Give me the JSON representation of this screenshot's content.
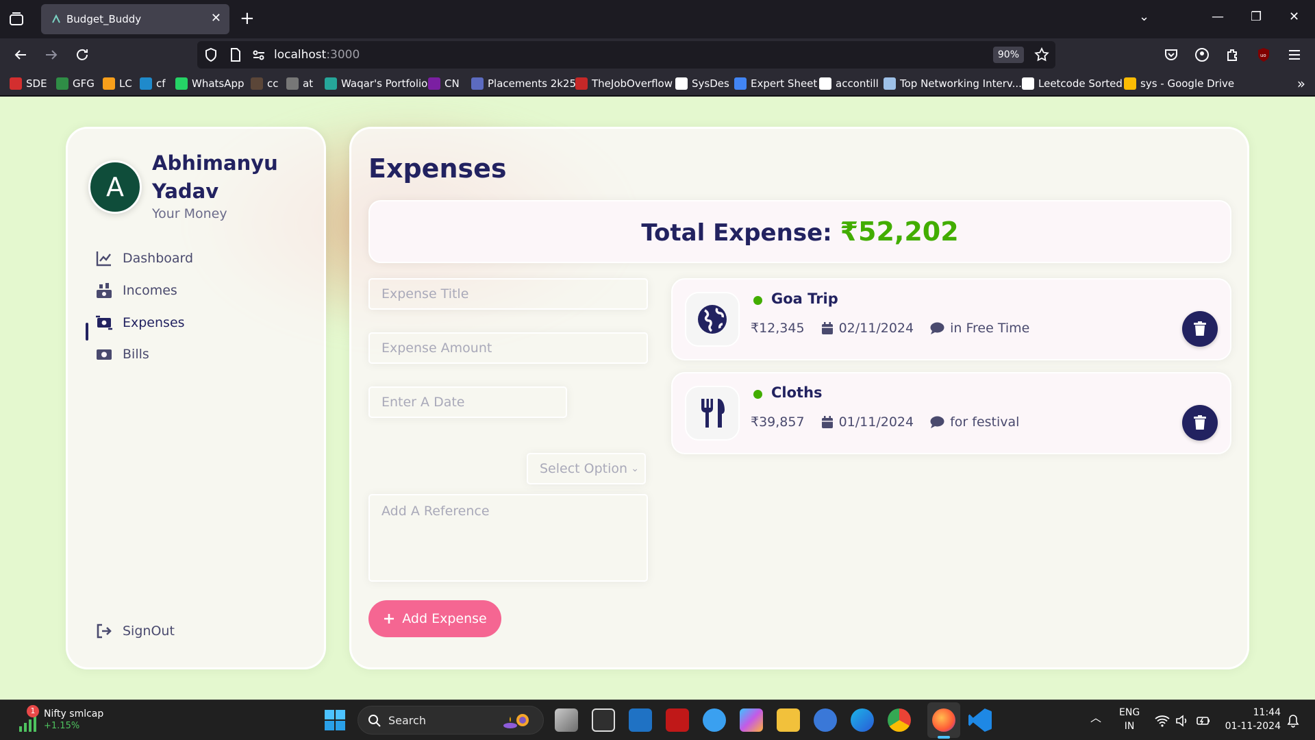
{
  "browser": {
    "tab_title": "Budget_Buddy",
    "url_host": "localhost",
    "url_port": ":3000",
    "zoom": "90%",
    "bookmarks": [
      {
        "label": "SDE",
        "icon": "tuf-icon",
        "color": "#d32f2f"
      },
      {
        "label": "GFG",
        "icon": "gfg-icon",
        "color": "#2f8d46"
      },
      {
        "label": "LC",
        "icon": "leetcode-icon",
        "color": "#f89f1b"
      },
      {
        "label": "cf",
        "icon": "codeforces-icon",
        "color": "#1f8acb"
      },
      {
        "label": "WhatsApp",
        "icon": "whatsapp-icon",
        "color": "#25d366"
      },
      {
        "label": "cc",
        "icon": "codechef-icon",
        "color": "#5b4638"
      },
      {
        "label": "at",
        "icon": "atcoder-icon",
        "color": "#777777"
      },
      {
        "label": "Waqar's Portfolio",
        "icon": "portfolio-icon",
        "color": "#26a69a"
      },
      {
        "label": "CN",
        "icon": "cn-icon",
        "color": "#7b1fa2"
      },
      {
        "label": "Placements 2k25",
        "icon": "people-icon",
        "color": "#5c6bc0"
      },
      {
        "label": "TheJobOverflow",
        "icon": "jobs-icon",
        "color": "#c62828"
      },
      {
        "label": "SysDes",
        "icon": "github-icon",
        "color": "#ffffff"
      },
      {
        "label": "Expert Sheet",
        "icon": "docs-icon",
        "color": "#4285f4"
      },
      {
        "label": "accontill",
        "icon": "github-icon",
        "color": "#ffffff"
      },
      {
        "label": "Top Networking Interv...",
        "icon": "mountain-icon",
        "color": "#9ec1e8"
      },
      {
        "label": "Leetcode Sorted",
        "icon": "globe-icon",
        "color": "#ffffff"
      },
      {
        "label": "sys - Google Drive",
        "icon": "drive-icon",
        "color": "#fbbc04"
      }
    ]
  },
  "sidebar": {
    "avatar_letter": "A",
    "user_name": "Abhimanyu Yadav",
    "tagline": "Your Money",
    "items": [
      {
        "label": "Dashboard",
        "icon": "chart-line-icon"
      },
      {
        "label": "Incomes",
        "icon": "money-stack-icon"
      },
      {
        "label": "Expenses",
        "icon": "money-exchange-icon"
      },
      {
        "label": "Bills",
        "icon": "money-bill-icon"
      }
    ],
    "active_item": "Expenses",
    "signout_label": "SignOut"
  },
  "main": {
    "title": "Expenses",
    "total_label": "Total Expense:",
    "total_amount": "₹52,202",
    "form": {
      "title_placeholder": "Expense Title",
      "amount_placeholder": "Expense Amount",
      "date_placeholder": "Enter A Date",
      "category_selected": "Select Option",
      "reference_placeholder": "Add A Reference",
      "submit_label": "Add Expense"
    },
    "expenses": [
      {
        "title": "Goa Trip",
        "amount": "₹12,345",
        "date": "02/11/2024",
        "note": "in Free Time",
        "icon": "globe-icon"
      },
      {
        "title": "Cloths",
        "amount": "₹39,857",
        "date": "01/11/2024",
        "note": "for festival",
        "icon": "utensils-icon"
      }
    ],
    "accent_colors": {
      "primary": "#222260",
      "green": "#42ad00",
      "pink": "#f56692"
    }
  },
  "taskbar": {
    "widget_title": "Nifty smlcap",
    "widget_value": "+1.15%",
    "widget_badge": "1",
    "search_label": "Search",
    "lang_line1": "ENG",
    "lang_line2": "IN",
    "time": "11:44",
    "date": "01-11-2024"
  }
}
